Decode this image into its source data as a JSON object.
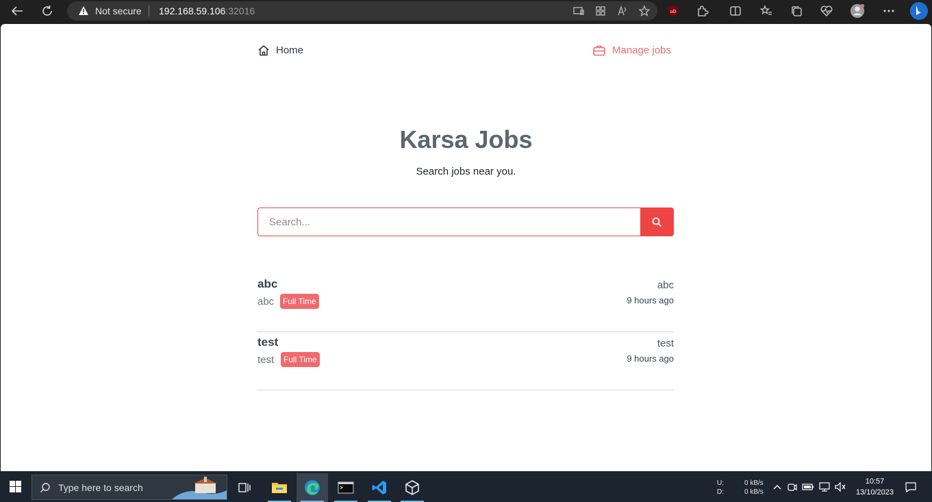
{
  "browser": {
    "security_label": "Not secure",
    "host": "192.168.59.106",
    "port": ":32016"
  },
  "nav": {
    "home_label": "Home",
    "manage_label": "Manage jobs"
  },
  "hero": {
    "title": "Karsa Jobs",
    "subtitle": "Search jobs near you."
  },
  "search": {
    "placeholder": "Search...",
    "value": ""
  },
  "jobs": [
    {
      "title": "abc",
      "company": "abc",
      "type": "Full Time",
      "location": "abc",
      "posted": "9 hours ago"
    },
    {
      "title": "test",
      "company": "test",
      "type": "Full Time",
      "location": "test",
      "posted": "9 hours ago"
    }
  ],
  "taskbar": {
    "search_placeholder": "Type here to search",
    "net_up_label": "U:",
    "net_down_label": "D:",
    "net_up": "0 kB/s",
    "net_down": "0 kB/s",
    "time": "10:57",
    "date": "13/10/2023"
  },
  "colors": {
    "accent": "#ef4444",
    "badge": "#f06a6d",
    "link": "#ee6b6e"
  }
}
